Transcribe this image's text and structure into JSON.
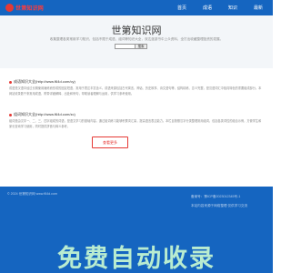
{
  "header": {
    "logo_text": "世第知识网",
    "nav": [
      "首页",
      "成语",
      "知识",
      "最新"
    ]
  },
  "hero": {
    "title": "世第知识网",
    "description": "收集整理各类常用学习知识，包括不限于成语、组词等知识大全，双达漫游书中上众资料，全打出收藏整理投资的发展。",
    "search": {
      "value": "",
      "placeholder": "",
      "button_label": "搜索"
    }
  },
  "articles": [
    {
      "title": "成语知识大全(http://www.f64d.com/cy)",
      "body": "成语是汉语中经过长期使用锤炼而形成的固定短语，常用于表达丰富含义。成语来源包括古代寓言、神话、历史故事、诗文语句等，结构精练、意义完整，是汉语词汇中极具特色的重要组成部分。本网站收录数千条常用成语，附带详细解释、出处和例句，帮助读者理解与运用，供学习参考使用。"
    },
    {
      "title": "组词知识大全(http://www.f64d.com/zc)",
      "body": "组词是由汉字一、二、三、四字组成的词语，是语文学习的基础内容。通过组词练习能够积累词汇量，提高语言表达能力。本栏目按照汉字分类整理常用组词，包括各类词性的组合示例，方便学生和家长查询学习使用，同时提供拼音与释义参考。"
    }
  ],
  "more_button": "查看更多",
  "footer": {
    "copyright": "© 2024  世第知识网 www.f64d.com",
    "links": [
      "备案号：豫ICP备2023012345号-1",
      "本站内容来源于网络整理 仅供学习交流"
    ]
  },
  "watermark": "免费自动收录"
}
